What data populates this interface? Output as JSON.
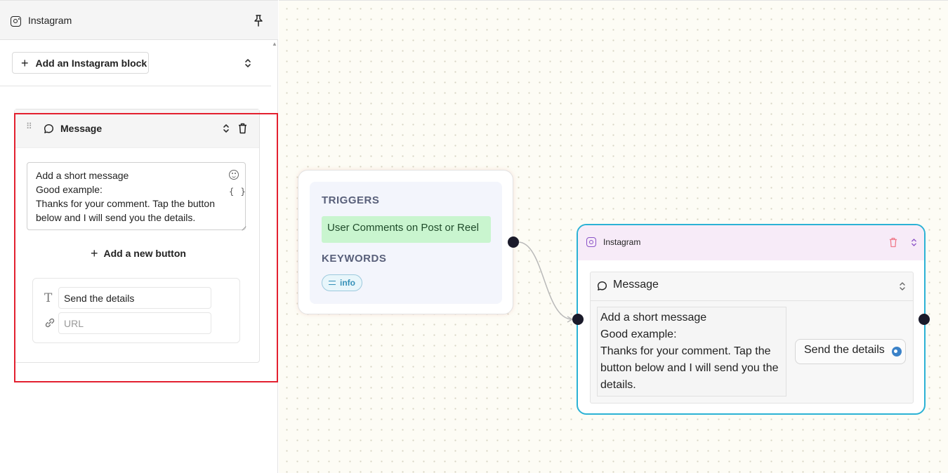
{
  "sidebar": {
    "title": "Instagram",
    "add_block_label": "Add an Instagram block",
    "message_card": {
      "title": "Message",
      "message_text": "Add a short message\nGood example:\nThanks for your comment. Tap the button below and I will send you the details.",
      "vars_label": "{ }",
      "add_button_label": "Add a new button",
      "button_text_value": "Send the details",
      "button_url_placeholder": "URL"
    }
  },
  "canvas": {
    "trigger_node": {
      "triggers_label": "TRIGGERS",
      "trigger_value": "User Comments on Post or Reel",
      "keywords_label": "KEYWORDS",
      "keyword_chip": "info"
    },
    "instagram_node": {
      "title": "Instagram",
      "message_title": "Message",
      "message_text": "Add a short message\nGood example:\nThanks for your comment. Tap the button below and I will send you the details.",
      "button_label": "Send the details"
    }
  },
  "colors": {
    "highlight": "#e3202f",
    "node_border": "#2bb2d5",
    "trigger_pill": "#c9f5cf",
    "keyword_chip": "#3490b8"
  }
}
